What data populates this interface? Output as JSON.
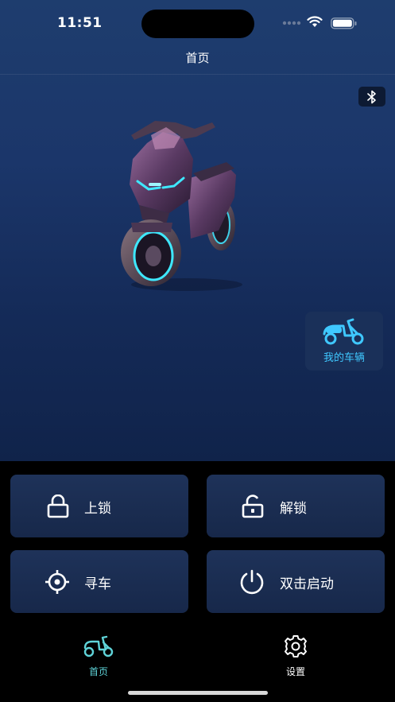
{
  "status_bar": {
    "time": "11:51"
  },
  "nav": {
    "title": "首页"
  },
  "vehicle_card": {
    "label": "我的车辆"
  },
  "controls": {
    "lock": "上锁",
    "unlock": "解锁",
    "find": "寻车",
    "start": "双击启动"
  },
  "tabs": [
    {
      "label": "首页",
      "active": true
    },
    {
      "label": "设置",
      "active": false
    }
  ],
  "colors": {
    "accent": "#3fc8ff",
    "tab_active": "#5fd3d8"
  }
}
